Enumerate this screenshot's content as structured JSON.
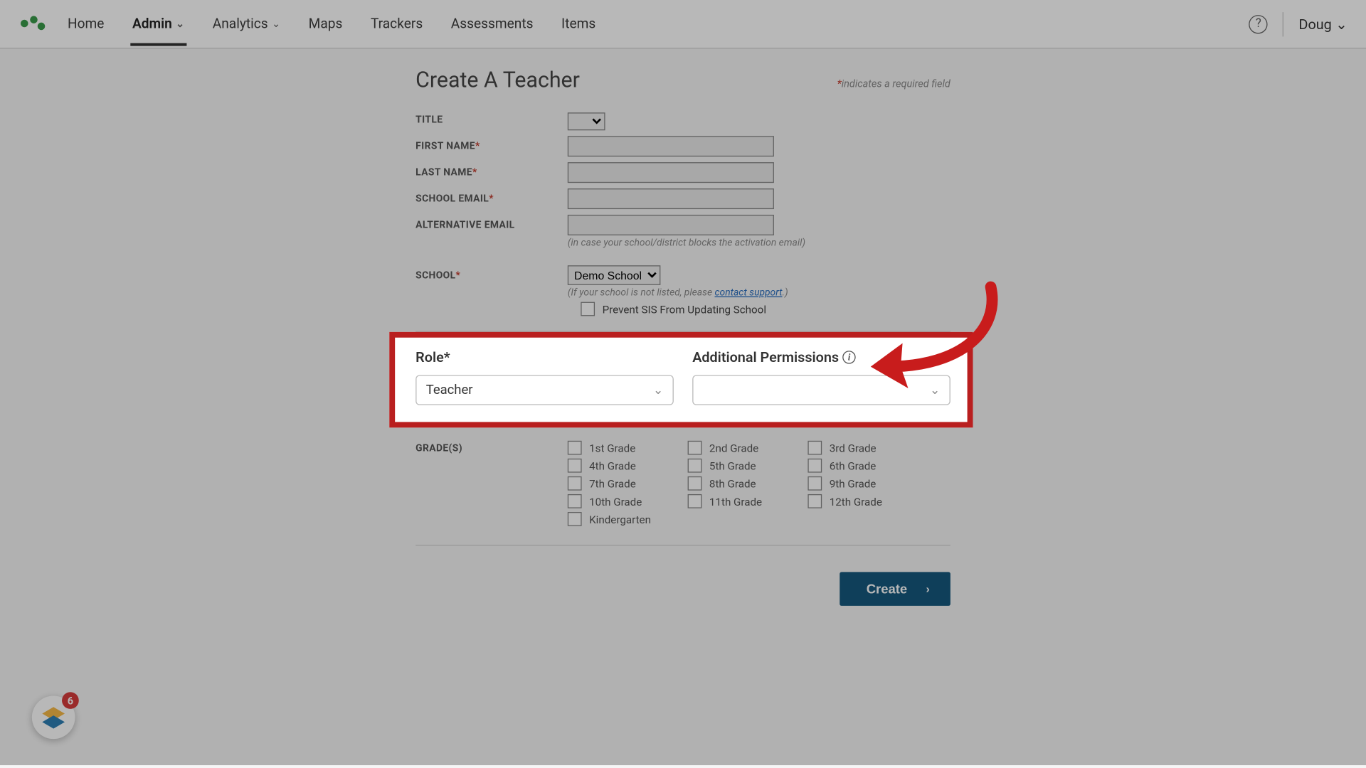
{
  "nav": {
    "items": [
      {
        "label": "Home"
      },
      {
        "label": "Admin",
        "dropdown": true,
        "active": true
      },
      {
        "label": "Analytics",
        "dropdown": true
      },
      {
        "label": "Maps"
      },
      {
        "label": "Trackers"
      },
      {
        "label": "Assessments"
      },
      {
        "label": "Items"
      }
    ],
    "user": "Doug"
  },
  "page": {
    "title": "Create A Teacher",
    "required_note": "*indicates a required field"
  },
  "fields": {
    "title_label": "TITLE",
    "first_name_label": "FIRST NAME",
    "last_name_label": "LAST NAME",
    "school_email_label": "SCHOOL EMAIL",
    "alt_email_label": "ALTERNATIVE EMAIL",
    "alt_email_hint": "(in case your school/district blocks the activation email)",
    "school_label": "SCHOOL",
    "school_value": "Demo School",
    "school_hint_pre": "(If your school is not listed, please ",
    "school_hint_link": "contact support",
    "school_hint_post": ".)",
    "prevent_sis_label": "Prevent SIS From Updating School"
  },
  "role": {
    "role_label": "Role*",
    "role_value": "Teacher",
    "perm_label": "Additional Permissions",
    "perm_value": ""
  },
  "grades": {
    "label": "GRADE(S)",
    "items": [
      "1st Grade",
      "2nd Grade",
      "3rd Grade",
      "4th Grade",
      "5th Grade",
      "6th Grade",
      "7th Grade",
      "8th Grade",
      "9th Grade",
      "10th Grade",
      "11th Grade",
      "12th Grade",
      "Kindergarten"
    ]
  },
  "actions": {
    "create": "Create"
  },
  "widget": {
    "badge": "6"
  }
}
